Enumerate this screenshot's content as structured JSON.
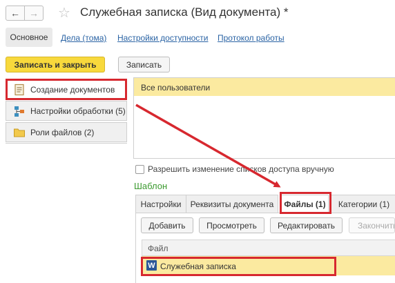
{
  "window": {
    "title": "Служебная записка (Вид документа) *"
  },
  "tabs": {
    "main": "Основное",
    "links": [
      "Дела (тома)",
      "Настройки доступности",
      "Протокол работы"
    ]
  },
  "toolbar": {
    "save_close": "Записать и закрыть",
    "save": "Записать"
  },
  "left_panel": {
    "items": [
      {
        "label": "Создание документов",
        "icon": "document-icon"
      },
      {
        "label": "Настройки обработки (5)",
        "icon": "workflow-icon"
      },
      {
        "label": "Роли файлов (2)",
        "icon": "folder-icon"
      }
    ]
  },
  "access": {
    "header": "Все пользователи",
    "checkbox_label": "Разрешить изменение списков доступа вручную",
    "checkbox_checked": false
  },
  "template": {
    "title": "Шаблон",
    "tabs": [
      "Настройки",
      "Реквизиты документа",
      "Файлы (1)",
      "Категории (1)"
    ],
    "active_tab": "Файлы (1)",
    "buttons": {
      "add": "Добавить",
      "view": "Просмотреть",
      "edit": "Редактировать",
      "finish": "Закончить"
    },
    "table": {
      "header": "Файл",
      "rows": [
        "Служебная записка"
      ]
    }
  },
  "colors": {
    "accent_yellow": "#f8d93c",
    "highlight_red": "#d7282f",
    "selection": "#fbeaa0",
    "section_green": "#3b9a2f"
  }
}
